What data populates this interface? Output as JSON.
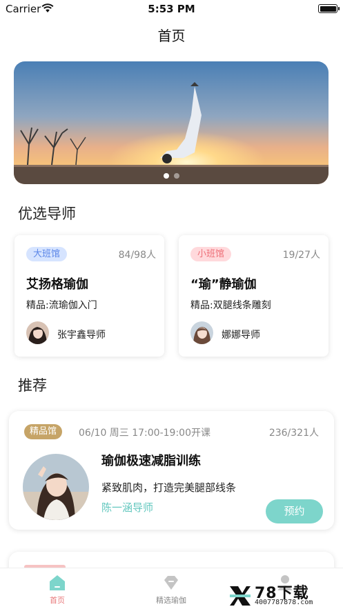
{
  "status_bar": {
    "carrier": "Carrier",
    "time": "5:53 PM"
  },
  "nav": {
    "title": "首页"
  },
  "banner": {
    "page_count": 2,
    "active_page": 1
  },
  "sections": {
    "teachers_title": "优选导师",
    "recommend_title": "推荐"
  },
  "teacher_cards": [
    {
      "tag": "大班馆",
      "count": "84/98人",
      "name": "艾扬格瑜伽",
      "course": "精品:流瑜伽入门",
      "teacher": "张宇鑫导师"
    },
    {
      "tag": "小班馆",
      "count": "19/27人",
      "name": "“瑜”静瑜伽",
      "course": "精品:双腿线条雕刻",
      "teacher": "娜娜导师"
    }
  ],
  "recommend": [
    {
      "tag": "精品馆",
      "time": "06/10 周三 17:00-19:00开课",
      "count": "236/321人",
      "name": "瑜伽极速减脂训练",
      "desc": "紧致肌肉，打造完美腿部线条",
      "teacher": "陈一涵导师",
      "button": "预约"
    }
  ],
  "tabs": [
    {
      "label": "首页",
      "icon": "home-icon",
      "active": true
    },
    {
      "label": "精选瑜伽",
      "icon": "diamond-icon",
      "active": false
    },
    {
      "label": "",
      "icon": "person-icon",
      "active": false
    }
  ],
  "watermark": {
    "brand": "78下载",
    "url": "4007787878.com"
  },
  "colors": {
    "accent": "#7dd5cb",
    "teacher_name": "#62c7be",
    "tab_active": "#e8787a",
    "premium_tag": "#c6a467"
  }
}
